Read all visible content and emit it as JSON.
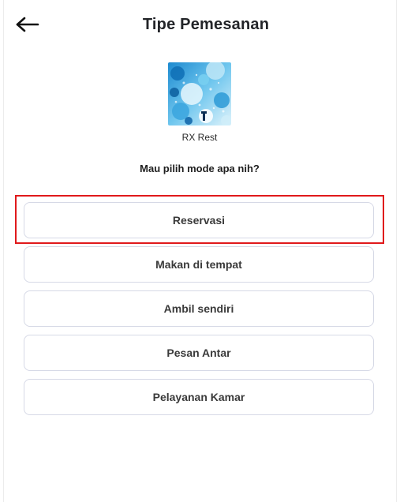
{
  "header": {
    "title": "Tipe Pemesanan",
    "back_icon": "arrow-left-icon"
  },
  "store": {
    "name": "RX Rest",
    "logo_icon": "store-logo-image"
  },
  "prompt": "Mau pilih mode apa nih?",
  "options": [
    {
      "label": "Reservasi",
      "selected": true
    },
    {
      "label": "Makan di tempat",
      "selected": false
    },
    {
      "label": "Ambil sendiri",
      "selected": false
    },
    {
      "label": "Pesan Antar",
      "selected": false
    },
    {
      "label": "Pelayanan Kamar",
      "selected": false
    }
  ],
  "colors": {
    "highlight": "#e0191b",
    "option_border": "#d6d9e6",
    "title": "#222428"
  }
}
